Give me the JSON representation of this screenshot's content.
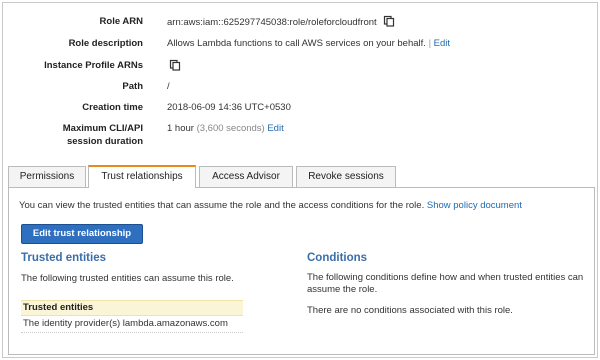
{
  "summary": {
    "role_arn": {
      "label": "Role ARN",
      "value": "arn:aws:iam::625297745038:role/roleforcloudfront"
    },
    "role_description": {
      "label": "Role description",
      "value": "Allows Lambda functions to call AWS services on your behalf.",
      "separator": "|",
      "edit": "Edit"
    },
    "instance_profile": {
      "label": "Instance Profile ARNs"
    },
    "path": {
      "label": "Path",
      "value": "/"
    },
    "creation_time": {
      "label": "Creation time",
      "value": "2018-06-09 14:36 UTC+0530"
    },
    "max_session": {
      "label_line1": "Maximum CLI/API",
      "label_line2": "session duration",
      "value": "1 hour",
      "detail": "(3,600 seconds)",
      "edit": "Edit"
    }
  },
  "tabs": [
    {
      "label": "Permissions",
      "active": false
    },
    {
      "label": "Trust relationships",
      "active": true
    },
    {
      "label": "Access Advisor",
      "active": false
    },
    {
      "label": "Revoke sessions",
      "active": false
    }
  ],
  "panel": {
    "intro": "You can view the trusted entities that can assume the role and the access conditions for the role.",
    "show_policy": "Show policy document",
    "edit_button": "Edit trust relationship",
    "trusted": {
      "heading": "Trusted entities",
      "desc": "The following trusted entities can assume this role.",
      "box_header": "Trusted entities",
      "entity": "The identity provider(s) lambda.amazonaws.com"
    },
    "conditions": {
      "heading": "Conditions",
      "desc": "The following conditions define how and when trusted entities can assume the role.",
      "none": "There are no conditions associated with this role."
    }
  },
  "colors": {
    "link": "#1f6ab0",
    "button": "#2f6fbf",
    "heading": "#3b6ea8",
    "tab_accent": "#e8891c",
    "highlight": "#fbf5d8"
  },
  "icons": {
    "copy": "copy-icon"
  }
}
